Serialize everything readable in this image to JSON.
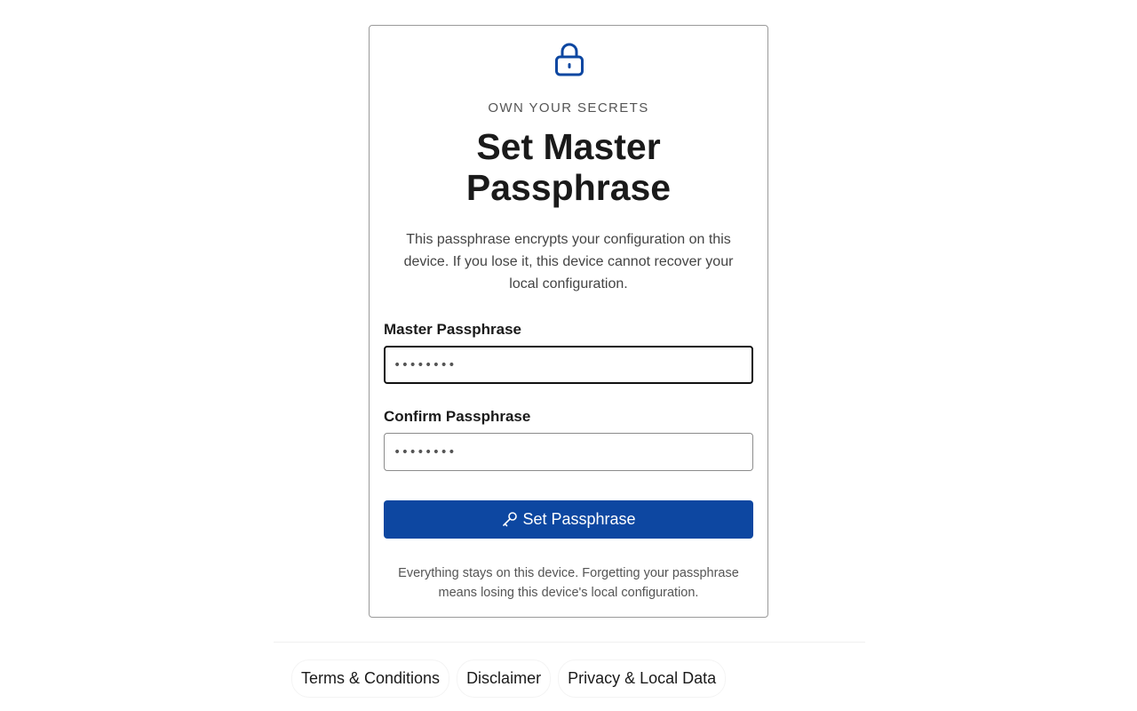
{
  "card": {
    "lock_icon": "lock-icon",
    "eyebrow": "OWN YOUR SECRETS",
    "title": "Set Master Passphrase",
    "description": "This passphrase encrypts your configuration on this device. If you lose it, this device cannot recover your local configuration.",
    "master": {
      "label": "Master Passphrase",
      "value": "••••••••"
    },
    "confirm": {
      "label": "Confirm Passphrase",
      "value": "••••••••"
    },
    "submit": {
      "icon": "key-icon",
      "label": "Set Passphrase"
    },
    "footnote": "Everything stays on this device. Forgetting your passphrase means losing this device's local configuration."
  },
  "footer": {
    "links": [
      "Terms & Conditions",
      "Disclaimer",
      "Privacy & Local Data"
    ]
  },
  "colors": {
    "accent": "#0d47a1",
    "icon": "#0d47a1"
  }
}
